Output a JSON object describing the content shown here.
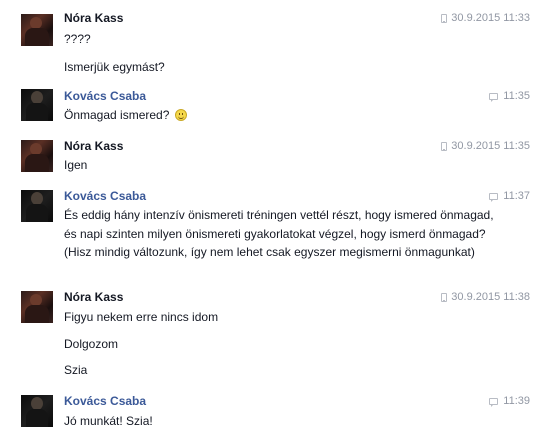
{
  "messages": [
    {
      "sender": "Nóra Kass",
      "time": "30.9.2015 11:33",
      "source": "mobile",
      "lines": [
        "????",
        "Ismerjük egymást?"
      ]
    },
    {
      "sender": "Kovács Csaba",
      "time": "11:35",
      "source": "chat",
      "lines": [
        "Önmagad ismered?"
      ],
      "emoji": "smile"
    },
    {
      "sender": "Nóra Kass",
      "time": "30.9.2015 11:35",
      "source": "mobile",
      "lines": [
        "Igen"
      ]
    },
    {
      "sender": "Kovács Csaba",
      "time": "11:37",
      "source": "chat",
      "lines": [
        "És eddig hány intenzív önismereti tréningen vettél részt, hogy ismered önmagad, és napi szinten milyen önismereti gyakorlatokat végzel, hogy ismerd önmagad? (Hisz mindig változunk, így nem lehet csak egyszer megismerni önmagunkat)"
      ]
    },
    {
      "sender": "Nóra Kass",
      "time": "30.9.2015 11:38",
      "source": "mobile",
      "lines": [
        "Figyu nekem erre nincs idom",
        "Dolgozom",
        "Szia"
      ]
    },
    {
      "sender": "Kovács Csaba",
      "time": "11:39",
      "source": "chat",
      "lines": [
        "Jó munkát! Szia!"
      ]
    }
  ],
  "colors": {
    "sender_nora": "#141823",
    "sender_csaba": "#3b5998",
    "meta": "#9197a3"
  }
}
